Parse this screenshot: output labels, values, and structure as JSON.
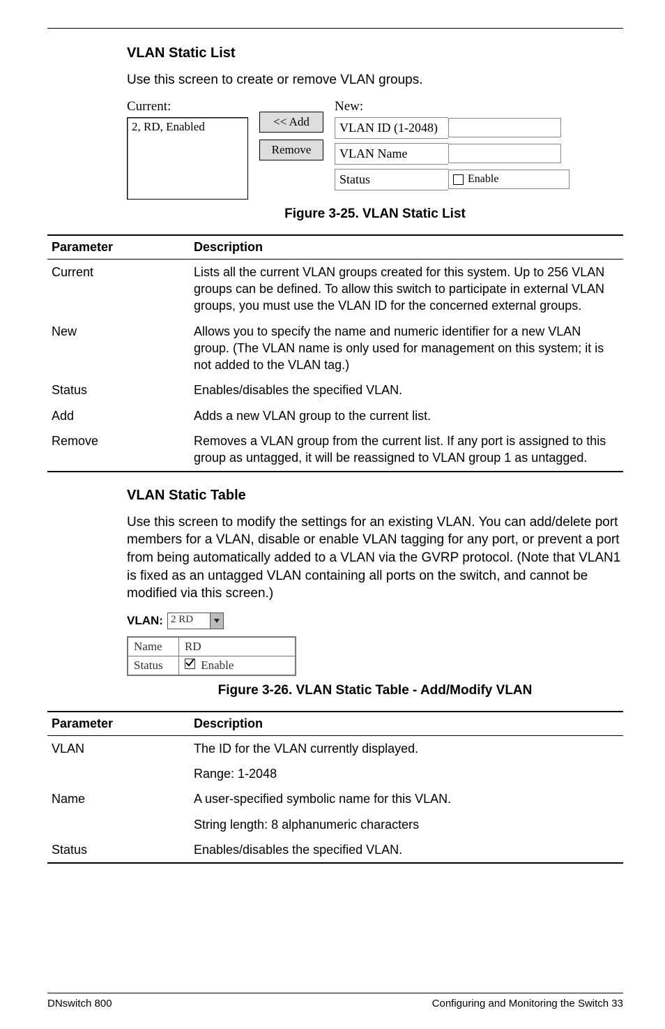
{
  "section1": {
    "title": "VLAN Static List",
    "intro": "Use this screen to create or remove VLAN groups.",
    "currentLabel": "Current:",
    "newLabel": "New:",
    "listItem": "2, RD, Enabled",
    "addBtn": "<< Add",
    "removeBtn": "Remove",
    "row1Label": "VLAN ID (1-2048)",
    "row2Label": "VLAN Name",
    "row3Label": "Status",
    "enableLabel": "Enable",
    "figcap": "Figure 3-25.  VLAN Static List"
  },
  "table1": {
    "h1": "Parameter",
    "h2": "Description",
    "r1c1": "Current",
    "r1c2": "Lists all the current VLAN groups created for this system. Up to 256 VLAN groups can be defined. To allow this switch to participate in external VLAN groups, you must use the VLAN ID for the concerned external groups.",
    "r2c1": "New",
    "r2c2": "Allows you to specify the name and numeric identifier for a new VLAN group. (The VLAN name is only used for management on this system; it is not added to the VLAN tag.)",
    "r3c1": "Status",
    "r3c2": "Enables/disables the specified VLAN.",
    "r4c1": "Add",
    "r4c2": "Adds a new VLAN group to the current list.",
    "r5c1": "Remove",
    "r5c2": "Removes a VLAN group from the current list. If any port is assigned to this group as untagged, it will be reassigned to VLAN group 1 as untagged."
  },
  "section2": {
    "title": "VLAN Static Table",
    "para": "Use this screen to modify the settings for an existing VLAN. You can add/delete port members for a VLAN, disable or enable VLAN tagging for any port, or prevent a port from being automatically added to a VLAN via the GVRP protocol. (Note that VLAN1 is fixed as an untagged VLAN containing all ports on the switch, and cannot be modified via this screen.)",
    "vlanLabel": "VLAN:",
    "vlanValue": "2 RD",
    "nameLabel": "Name",
    "nameValue": "RD",
    "statusLabel": "Status",
    "enableLabel": "Enable",
    "figcap": "Figure 3-26.  VLAN Static Table - Add/Modify VLAN"
  },
  "table2": {
    "h1": "Parameter",
    "h2": "Description",
    "r1c1": "VLAN",
    "r1c2a": "The ID for the VLAN currently displayed.",
    "r1c2b": "Range: 1-2048",
    "r2c1": "Name",
    "r2c2a": "A user-specified symbolic name for this VLAN.",
    "r2c2b": "String length: 8 alphanumeric characters",
    "r3c1": "Status",
    "r3c2": "Enables/disables the specified VLAN."
  },
  "footer": {
    "left": "DNswitch 800",
    "right": "Configuring and Monitoring the Switch  33"
  }
}
